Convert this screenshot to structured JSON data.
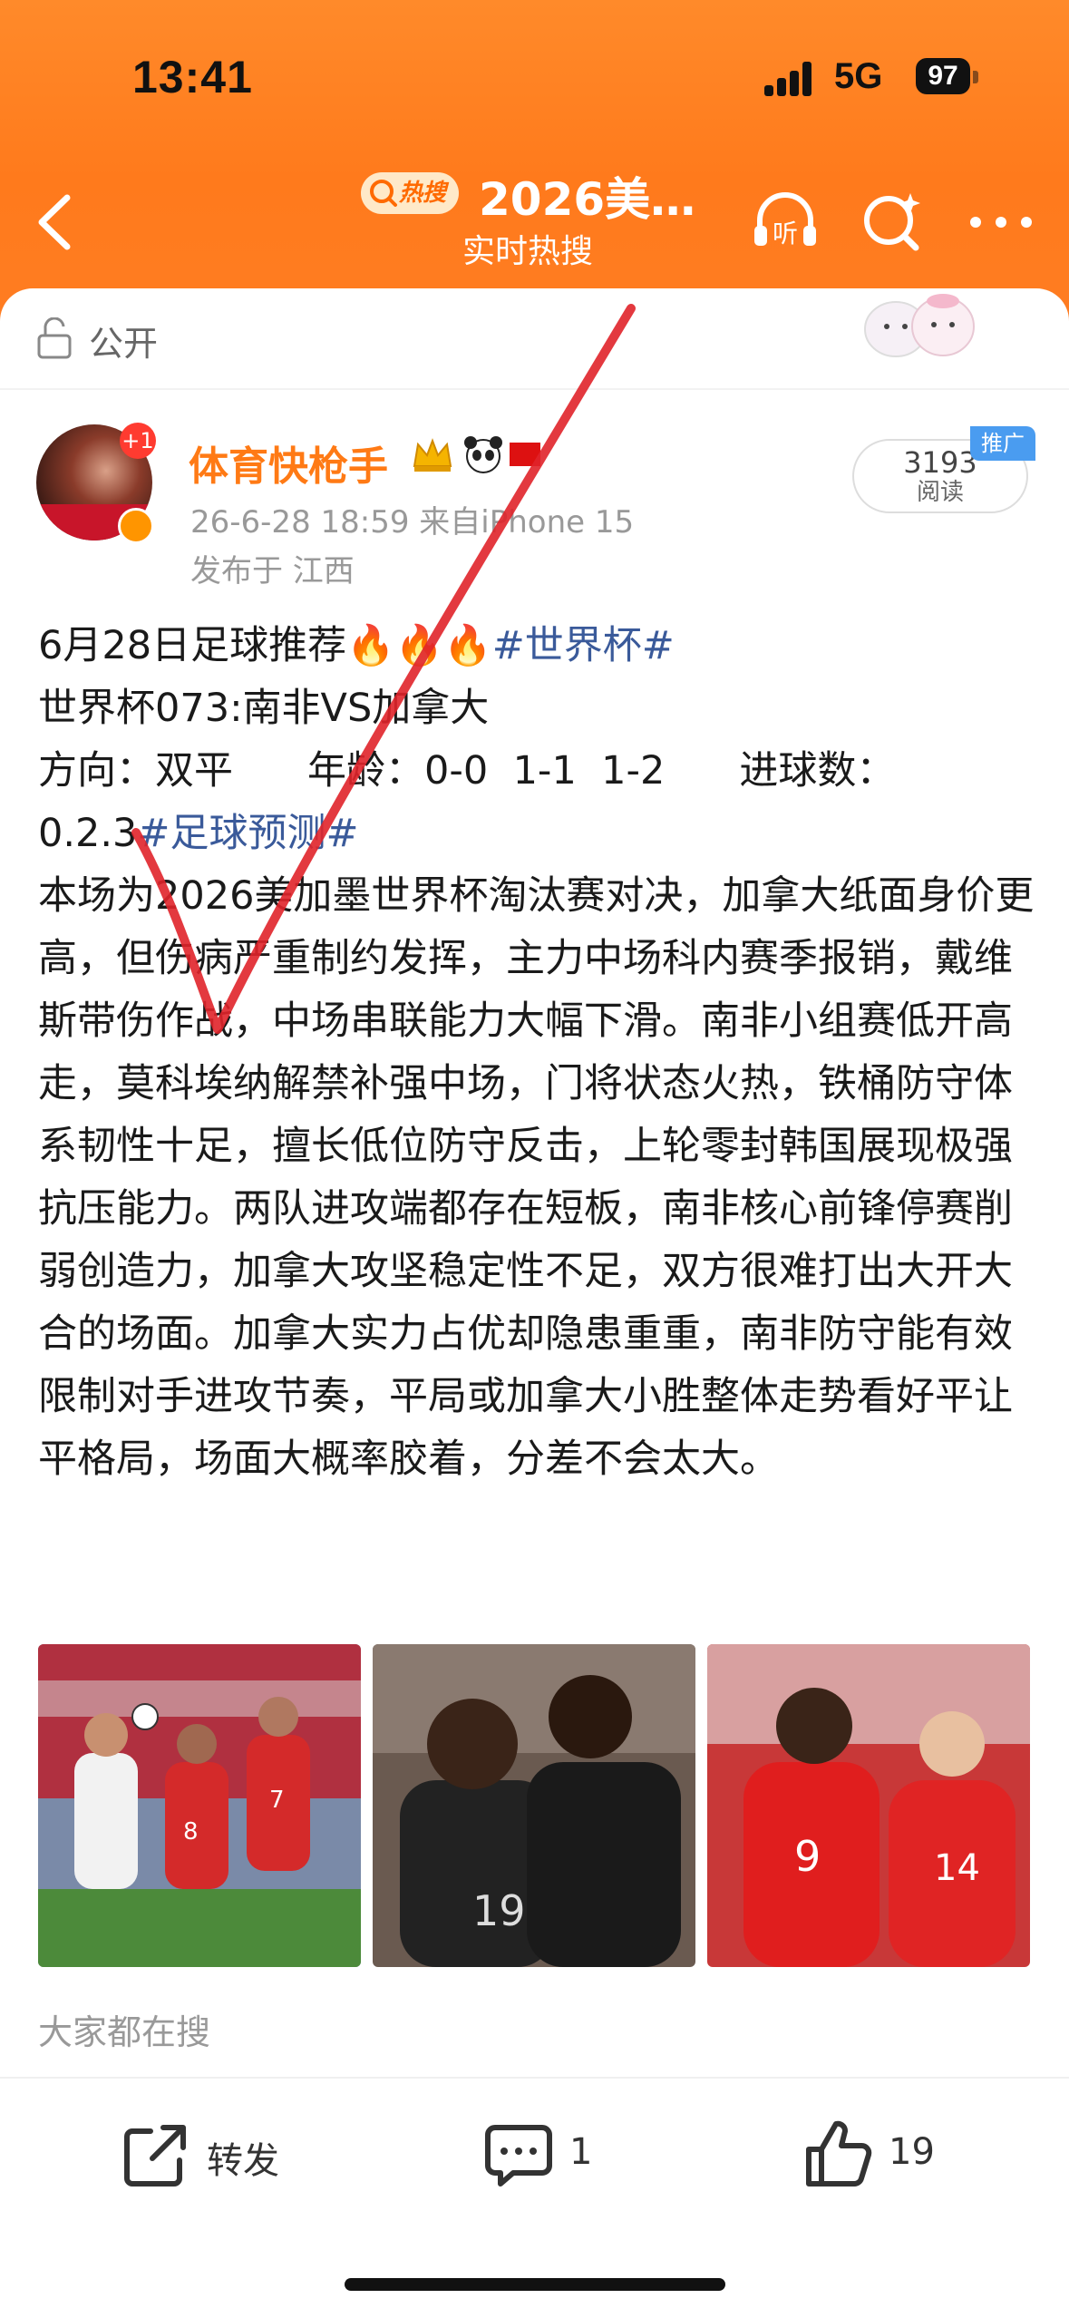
{
  "status_bar": {
    "time": "13:41",
    "network": "5G",
    "battery": "97"
  },
  "nav": {
    "hot_badge": "热搜",
    "title": "2026美…",
    "subtitle": "实时热搜",
    "icons": [
      "back-arrow-icon",
      "listen-icon",
      "search-sparkle-icon",
      "more-icon"
    ],
    "listen_label": "听"
  },
  "visibility": "公开",
  "post": {
    "author": "体育快枪手",
    "date_line": "26-6-28 18:59  来自iPhone 15",
    "location": "发布于 江西",
    "notification_count": "+1",
    "reads": {
      "count": "3193",
      "label": "阅读",
      "badge": "推广"
    },
    "line1_text": "6月28日足球推荐",
    "line1_tag": "#世界杯#",
    "line2": "世界杯073:南非VS加拿大",
    "line3": "方向：双平      年龄：0-0  1-1  1-2      进球数：",
    "line4_text": "0.2.3",
    "line4_tag": "#足球预测#",
    "body": "本场为2026美加墨世界杯淘汰赛对决，加拿大纸面身价更高，但伤病严重制约发挥，主力中场科内赛季报销，戴维斯带伤作战，中场串联能力大幅下滑。南非小组赛低开高走，莫科埃纳解禁补强中场，门将状态火热，铁桶防守体系韧性十足，擅长低位防守反击，上轮零封韩国展现极强抗压能力。两队进攻端都存在短板，南非核心前锋停赛削弱创造力，加拿大攻坚稳定性不足，双方很难打出大开大合的场面。加拿大实力占优却隐患重重，南非防守能有效限制对手进攻节奏，平局或加拿大小胜整体走势看好平让平格局，场面大概率胶着，分差不会太大。"
  },
  "photo_jerseys": [
    "19",
    "9",
    "14",
    "7",
    "8"
  ],
  "search_section": "大家都在搜",
  "actions": {
    "repost": "转发",
    "comments": "1",
    "likes": "19"
  },
  "colors": {
    "brand_orange": "#ff7a1c",
    "author_orange": "#ff7a15",
    "tag_blue": "#3a5a9a",
    "annotation_red": "#e0242a"
  }
}
